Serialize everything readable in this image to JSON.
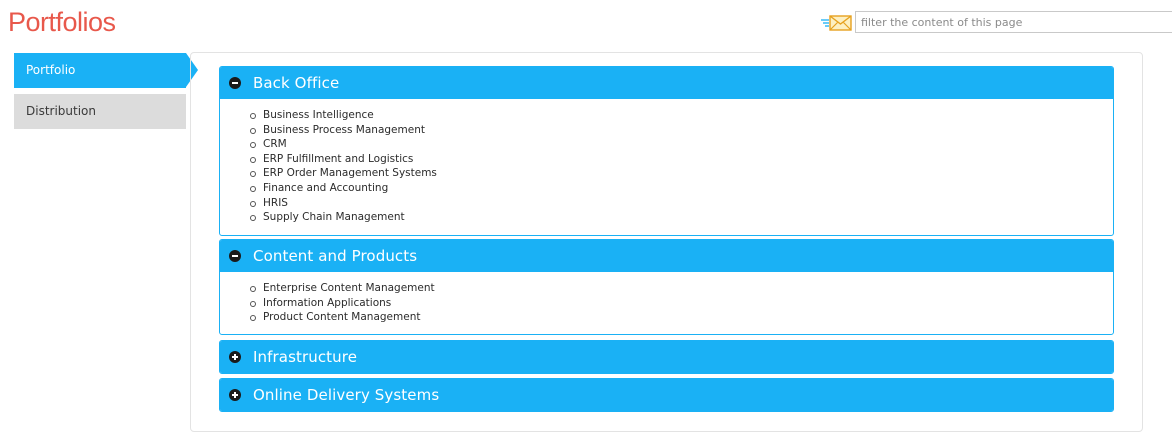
{
  "header": {
    "title": "Portfolios",
    "filter_placeholder": "filter the content of this page",
    "filter_value": ""
  },
  "sidebar": {
    "items": [
      {
        "label": "Portfolio",
        "active": true
      },
      {
        "label": "Distribution",
        "active": false
      }
    ]
  },
  "sections": [
    {
      "title": "Back Office",
      "expanded": true,
      "items": [
        "Business Intelligence",
        "Business Process Management",
        "CRM",
        "ERP Fulfillment and Logistics",
        "ERP Order Management Systems",
        "Finance and Accounting",
        "HRIS",
        "Supply Chain Management"
      ]
    },
    {
      "title": "Content and Products",
      "expanded": true,
      "items": [
        "Enterprise Content Management",
        "Information Applications",
        "Product Content Management"
      ]
    },
    {
      "title": "Infrastructure",
      "expanded": false,
      "items": []
    },
    {
      "title": "Online Delivery Systems",
      "expanded": false,
      "items": []
    }
  ],
  "icons": {
    "mail": "mail-icon",
    "collapse": "minus-circle-icon",
    "expand": "plus-circle-icon"
  },
  "colors": {
    "title": "#e8584b",
    "accent": "#1ab1f5",
    "sidebar_inactive": "#dcdcdc"
  }
}
